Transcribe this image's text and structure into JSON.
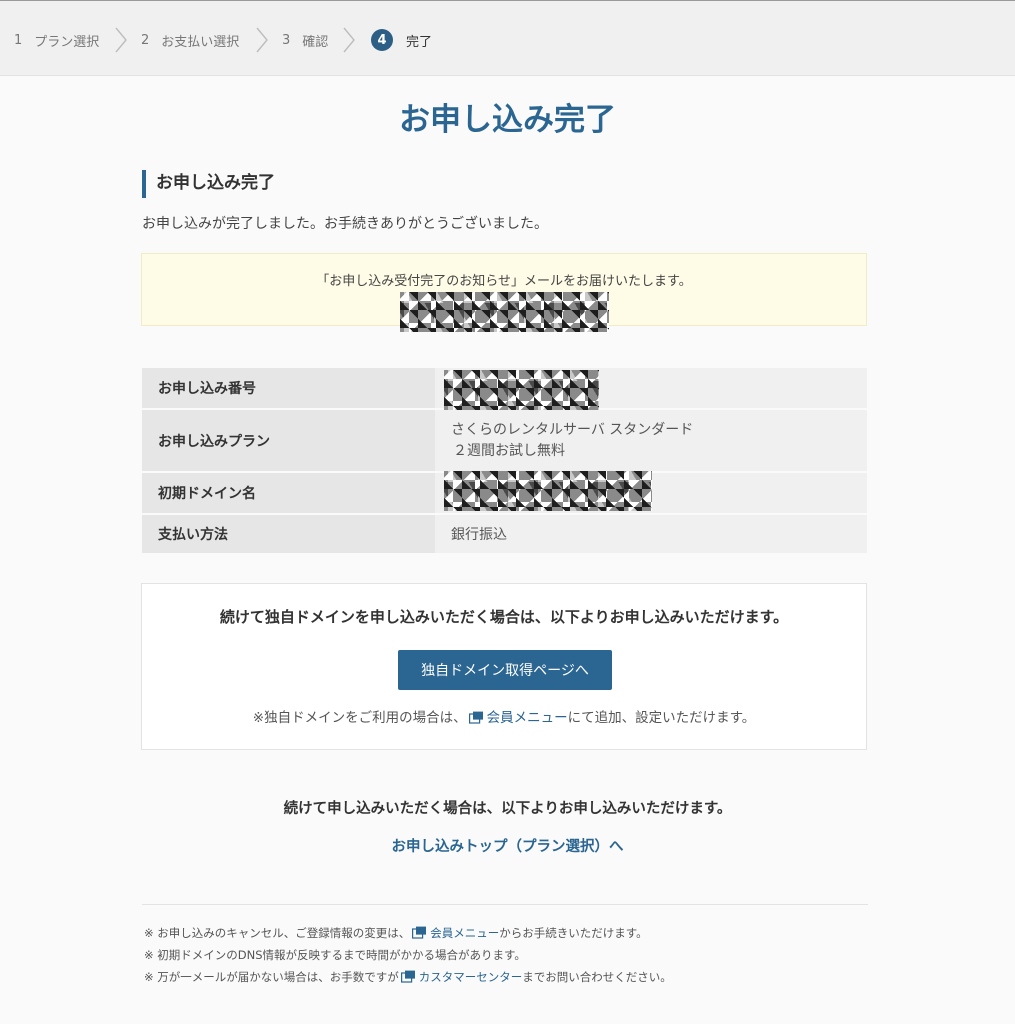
{
  "steps": [
    {
      "num": "1",
      "label": "プラン選択"
    },
    {
      "num": "2",
      "label": "お支払い選択"
    },
    {
      "num": "3",
      "label": "確認"
    },
    {
      "num": "4",
      "label": "完了"
    }
  ],
  "page_title": "お申し込み完了",
  "section_title": "お申し込み完了",
  "lead_text": "お申し込みが完了しました。お手続きありがとうございました。",
  "notice_text": "「お申し込み受付完了のお知らせ」メールをお届けいたします。",
  "details": [
    {
      "label": "お申し込み番号"
    },
    {
      "label": "お申し込みプラン",
      "value_line1": "さくらのレンタルサーバ スタンダード",
      "value_line2": "２週間お試し無料"
    },
    {
      "label": "初期ドメイン名"
    },
    {
      "label": "支払い方法",
      "value": "銀行振込"
    }
  ],
  "domain_box": {
    "message": "続けて独自ドメインを申し込みいただく場合は、以下よりお申し込みいただけます。",
    "button_label": "独自ドメイン取得ページへ",
    "note_prefix": "※独自ドメインをご利用の場合は、",
    "note_link": "会員メニュー",
    "note_suffix": "にて追加、設定いただけます。"
  },
  "continue_message": "続けて申し込みいただく場合は、以下よりお申し込みいただけます。",
  "top_link": "お申し込みトップ（プラン選択）へ",
  "footnotes": {
    "line1_prefix": "※ お申し込みのキャンセル、ご登録情報の変更は、",
    "line1_link": "会員メニュー",
    "line1_suffix": "からお手続きいただけます。",
    "line2": "※ 初期ドメインのDNS情報が反映するまで時間がかかる場合があります。",
    "line3_prefix": "※ 万が一メールが届かない場合は、お手数ですが",
    "line3_link": "カスタマーセンター",
    "line3_suffix": "までお問い合わせください。"
  },
  "colors": {
    "accent": "#2b6591",
    "notice_bg": "#fefbe6"
  }
}
